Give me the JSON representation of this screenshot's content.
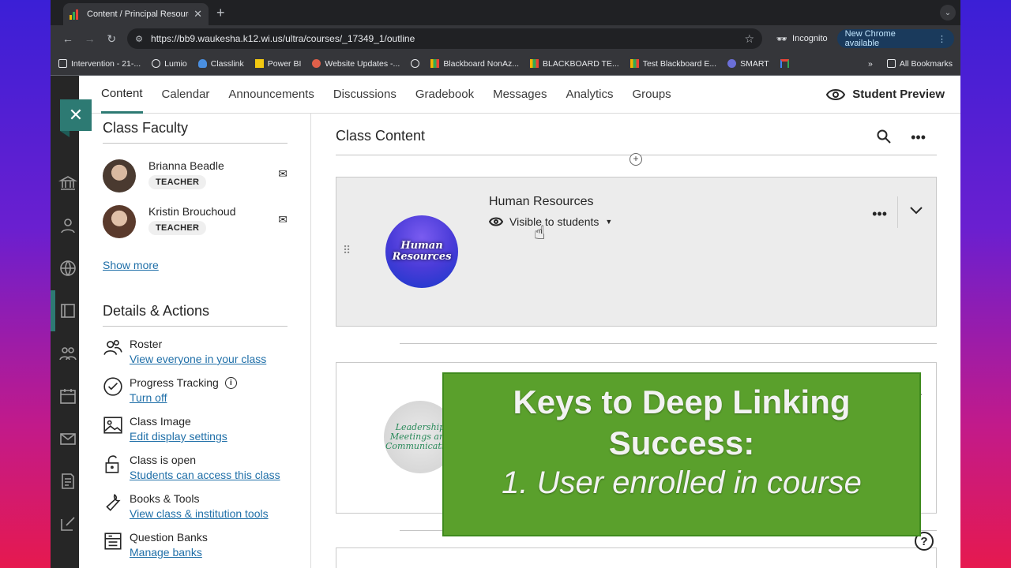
{
  "browser": {
    "tab_title": "Content / Principal Resources",
    "url": "https://bb9.waukesha.k12.wi.us/ultra/courses/_17349_1/outline",
    "incognito_label": "Incognito",
    "update_label": "New Chrome available",
    "bookmarks": [
      {
        "label": "Intervention - 21-...",
        "icon": "folder-icon"
      },
      {
        "label": "Lumio",
        "icon": "lumio-icon"
      },
      {
        "label": "Classlink",
        "icon": "cloud-icon"
      },
      {
        "label": "Power BI",
        "icon": "powerbi-icon"
      },
      {
        "label": "Website Updates -...",
        "icon": "pin-icon"
      },
      {
        "label": "",
        "icon": "globe-icon"
      },
      {
        "label": "Blackboard NonAz...",
        "icon": "blackboard-icon"
      },
      {
        "label": "BLACKBOARD TE...",
        "icon": "blackboard-icon"
      },
      {
        "label": "Test Blackboard E...",
        "icon": "blackboard-icon"
      },
      {
        "label": "SMART",
        "icon": "smart-icon"
      },
      {
        "label": "",
        "icon": "gmail-icon"
      }
    ],
    "all_bookmarks_label": "All Bookmarks"
  },
  "nav": {
    "items": [
      "Content",
      "Calendar",
      "Announcements",
      "Discussions",
      "Gradebook",
      "Messages",
      "Analytics",
      "Groups"
    ],
    "active": "Content",
    "student_preview": "Student Preview"
  },
  "faculty": {
    "title": "Class Faculty",
    "people": [
      {
        "name": "Brianna Beadle",
        "role": "TEACHER"
      },
      {
        "name": "Kristin Brouchoud",
        "role": "TEACHER"
      }
    ],
    "show_more": "Show more"
  },
  "details": {
    "title": "Details & Actions",
    "actions": [
      {
        "title": "Roster",
        "link": "View everyone in your class",
        "icon": "roster-icon"
      },
      {
        "title": "Progress Tracking",
        "link": "Turn off",
        "icon": "check-circle-icon"
      },
      {
        "title": "Class Image",
        "link": "Edit display settings",
        "icon": "image-icon"
      },
      {
        "title": "Class is open",
        "link": "Students can access this class",
        "icon": "unlock-icon"
      },
      {
        "title": "Books & Tools",
        "link": "View class & institution tools",
        "icon": "wrench-icon"
      },
      {
        "title": "Question Banks",
        "link": "Manage banks",
        "icon": "question-bank-icon"
      }
    ]
  },
  "content": {
    "title": "Class Content",
    "card1": {
      "title": "Human Resources",
      "visibility": "Visible to students",
      "image_text_line1": "Human",
      "image_text_line2": "Resources"
    },
    "card2": {
      "image_text": "Leadership Meetings and Communication"
    }
  },
  "overlay": {
    "line1": "Keys to Deep Linking",
    "line2": "Success:",
    "line3": "1. User enrolled in course",
    "color": "#5aa02c"
  }
}
